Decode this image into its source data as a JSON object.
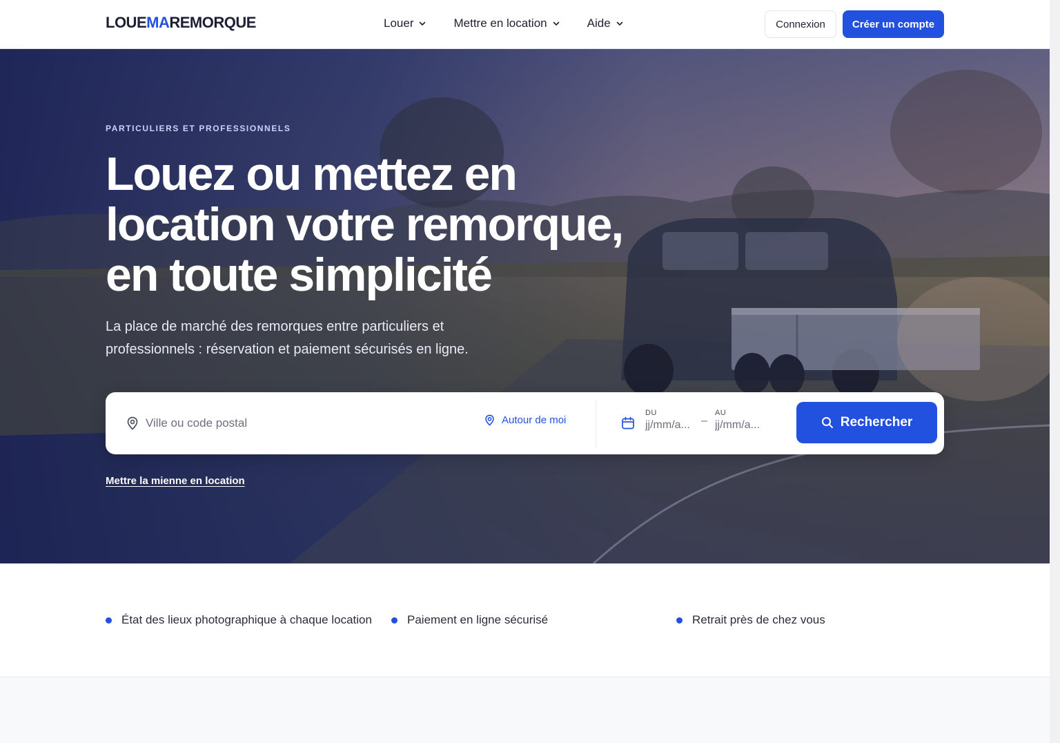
{
  "header": {
    "logo": {
      "part1": "LOUE",
      "part2": "MA",
      "part3": "REMORQUE"
    },
    "nav": [
      {
        "label": "Louer"
      },
      {
        "label": "Mettre en location"
      },
      {
        "label": "Aide"
      }
    ],
    "login_label": "Connexion",
    "signup_label": "Créer un compte"
  },
  "hero": {
    "eyebrow": "PARTICULIERS ET PROFESSIONNELS",
    "headline": "Louez ou mettez en location votre remorque, en toute simplicité",
    "subline": "La place de marché des remorques entre particuliers et professionnels : réservation et paiement sécurisés en ligne.",
    "search": {
      "city_placeholder": "Ville ou code postal",
      "near_me_label": "Autour de moi",
      "from_label": "DU",
      "from_placeholder": "jj/mm/a...",
      "to_label": "AU",
      "to_placeholder": "jj/mm/a...",
      "dash": "–",
      "search_label": "Rechercher"
    },
    "rent_mine_label": "Mettre la mienne en location"
  },
  "features": [
    {
      "label": "État des lieux photographique à chaque location"
    },
    {
      "label": "Paiement en ligne sécurisé"
    },
    {
      "label": "Retrait près de chez vous"
    }
  ],
  "colors": {
    "accent": "#2251e0",
    "hero_overlay": "#1c2456",
    "text_dark": "#1f2330"
  }
}
